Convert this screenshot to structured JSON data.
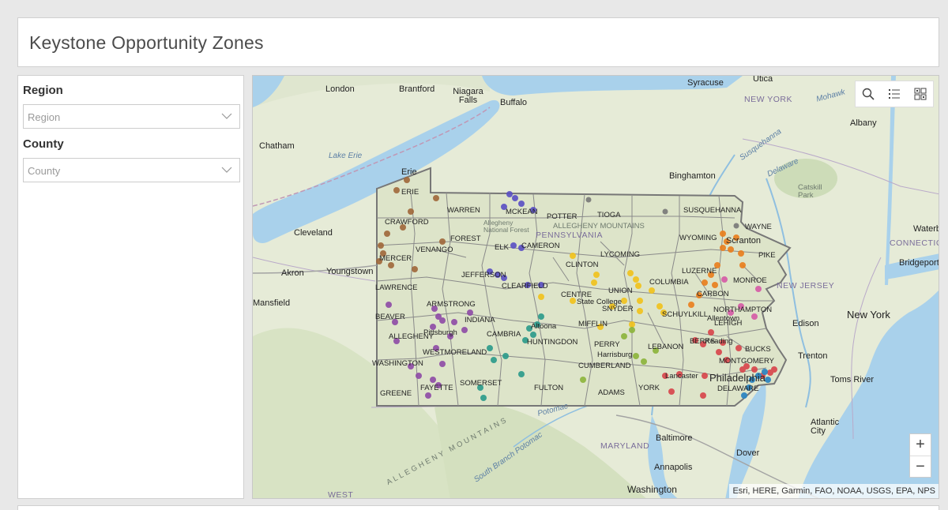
{
  "header": {
    "title": "Keystone Opportunity Zones"
  },
  "sidebar": {
    "region_label": "Region",
    "region_placeholder": "Region",
    "county_label": "County",
    "county_placeholder": "County"
  },
  "map": {
    "attribution": "Esri, HERE, Garmin, FAO, NOAA, USGS, EPA, NPS",
    "tools": [
      "search-icon",
      "legend-list-icon",
      "basemap-gallery-icon"
    ],
    "zoom_in": "+",
    "zoom_out": "−",
    "cities": [
      "Syracuse",
      "Utica",
      "London",
      "Brantford",
      "Niagara Falls",
      "Buffalo",
      "Albany",
      "Chatham",
      "Binghamton",
      "Cleveland",
      "Akron",
      "Youngstown",
      "Erie",
      "Scranton",
      "Waterbury",
      "Bridgeport",
      "New York",
      "Edison",
      "Trenton",
      "Toms River",
      "Philadelphia",
      "Harrisburg",
      "Lancaster",
      "Reading",
      "Baltimore",
      "Dover",
      "Annapolis",
      "Washington",
      "Atlantic City",
      "Pittsburgh",
      "Altoona",
      "State College",
      "Allentown",
      "Mansfield"
    ],
    "counties": [
      "ERIE",
      "WARREN",
      "MCKEAN",
      "POTTER",
      "TIOGA",
      "SUSQUEHANNA",
      "WAYNE",
      "CRAWFORD",
      "FOREST",
      "ELK",
      "CAMERON",
      "WYOMING",
      "PIKE",
      "VENANGO",
      "MERCER",
      "CLINTON",
      "LYCOMING",
      "LUZERNE",
      "MONROE",
      "JEFFERSON",
      "CLEARFIELD",
      "COLUMBIA",
      "LAWRENCE",
      "CENTRE",
      "UNION",
      "CARBON",
      "NORTHAMPTON",
      "ARMSTRONG",
      "SNYDER",
      "SCHUYLKILL",
      "LEHIGH",
      "BEAVER",
      "INDIANA",
      "MIFFLIN",
      "ALLEGHENY",
      "CAMBRIA",
      "HUNTINGDON",
      "PERRY",
      "BERKS",
      "BUCKS",
      "MONTGOMERY",
      "WESTMORELAND",
      "LEBANON",
      "WASHINGTON",
      "CUMBERLAND",
      "SOMERSET",
      "FULTON",
      "GREENE",
      "FAYETTE",
      "ADAMS",
      "YORK",
      "DELAWARE"
    ],
    "states": [
      "NEW YORK",
      "PENNSYLVANIA",
      "NEW JERSEY",
      "CONNECTICUT",
      "MARYLAND",
      "WEST"
    ],
    "water": [
      "Lake Erie",
      "Susquehanna",
      "Delaware",
      "Mohawk",
      "Potomac",
      "South Branch Potomac"
    ],
    "regions_terrain": [
      "ALLEGHENY MOUNTAINS",
      "Allegheny National Forest",
      "Catskill Park",
      "ALLEGHENY MOUNTAINS"
    ],
    "zone_colors": {
      "northwest": "#a0673a",
      "north_central": "#5a4fc4",
      "southwest": "#8e4aa6",
      "southern_alleghenies": "#2a9a8a",
      "central": "#f2c21b",
      "northeast": "#ea7d1c",
      "lehigh": "#d65aa6",
      "southcentral": "#8cb43a",
      "southeast": "#d8444a",
      "philadelphia": "#2e86c1",
      "north": "#777777"
    }
  }
}
